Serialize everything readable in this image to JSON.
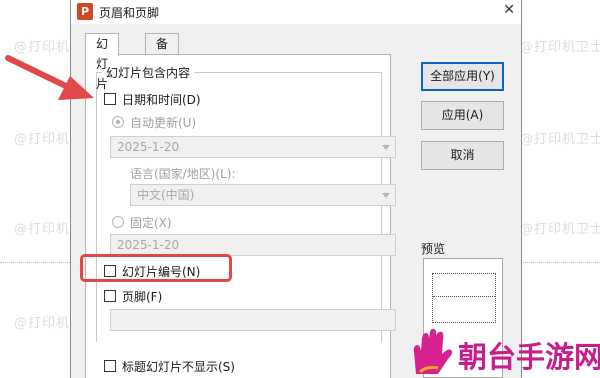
{
  "dialog": {
    "title": "页眉和页脚",
    "app_icon_letter": "P",
    "close_glyph": "✕"
  },
  "tabs": [
    {
      "label": "幻灯片",
      "active": true
    },
    {
      "label": "备注和讲义",
      "active": false
    }
  ],
  "group": {
    "label": "幻灯片包含内容",
    "date_time": {
      "label": "日期和时间(D)",
      "checked": false
    },
    "auto_update": {
      "label": "自动更新(U)",
      "selected": true,
      "value": "2025-1-20"
    },
    "language_label": "语言(国家/地区)(L):",
    "language_value": "中文(中国)",
    "fixed": {
      "label": "固定(X)",
      "selected": false,
      "value": "2025-1-20"
    },
    "slide_number": {
      "label": "幻灯片编号(N)",
      "checked": false
    },
    "footer": {
      "label": "页脚(F)",
      "checked": false,
      "value": ""
    }
  },
  "title_slide_option": {
    "label": "标题幻灯片不显示(S)",
    "checked": false
  },
  "buttons": {
    "apply_all": "全部应用(Y)",
    "apply": "应用(A)",
    "cancel": "取消"
  },
  "preview_label": "预览",
  "watermark": "@打印机卫士",
  "brand": "朝台手游网",
  "colors": {
    "highlight": "#e34848",
    "brand": "#c81e8c",
    "default_button_border": "#0a64c8"
  }
}
